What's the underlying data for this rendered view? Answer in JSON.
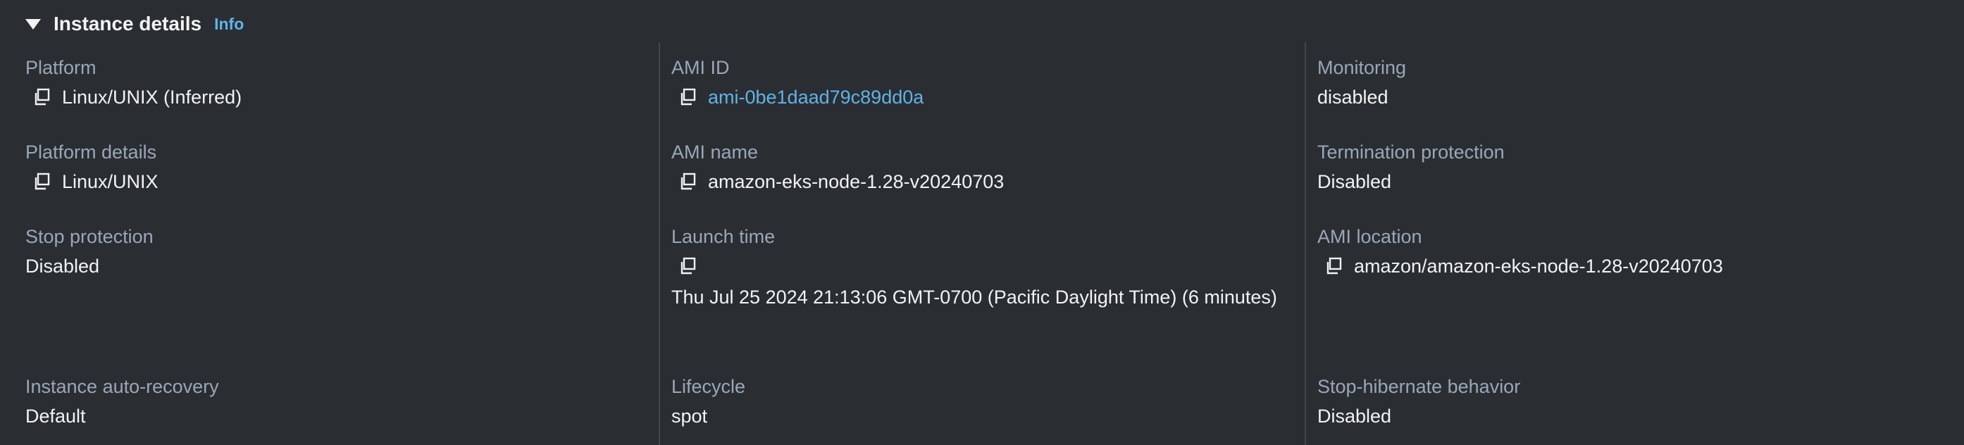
{
  "section": {
    "title": "Instance details",
    "info_label": "Info"
  },
  "columns": [
    {
      "fields": [
        {
          "label": "Platform",
          "value": "Linux/UNIX (Inferred)"
        },
        {
          "label": "Platform details",
          "value": "Linux/UNIX"
        },
        {
          "label": "Stop protection",
          "value": "Disabled"
        },
        {
          "label": "Instance auto-recovery",
          "value": "Default"
        }
      ]
    },
    {
      "fields": [
        {
          "label": "AMI ID",
          "value": "ami-0be1daad79c89dd0a"
        },
        {
          "label": "AMI name",
          "value": "amazon-eks-node-1.28-v20240703"
        },
        {
          "label": "Launch time",
          "value": "Thu Jul 25 2024 21:13:06 GMT-0700 (Pacific Daylight Time) (6 minutes)"
        },
        {
          "label": "Lifecycle",
          "value": "spot"
        }
      ]
    },
    {
      "fields": [
        {
          "label": "Monitoring",
          "value": "disabled"
        },
        {
          "label": "Termination protection",
          "value": "Disabled"
        },
        {
          "label": "AMI location",
          "value": "amazon/amazon-eks-node-1.28-v20240703"
        },
        {
          "label": "Stop-hibernate behavior",
          "value": "Disabled"
        }
      ]
    }
  ],
  "colors": {
    "background": "#2a2e33",
    "label": "#9ba7b6",
    "value": "#f2f3f3",
    "link": "#5fb4e6",
    "divider": "#41464d"
  },
  "icons": {
    "copy": "copy-icon",
    "expand": "caret-down-icon"
  }
}
